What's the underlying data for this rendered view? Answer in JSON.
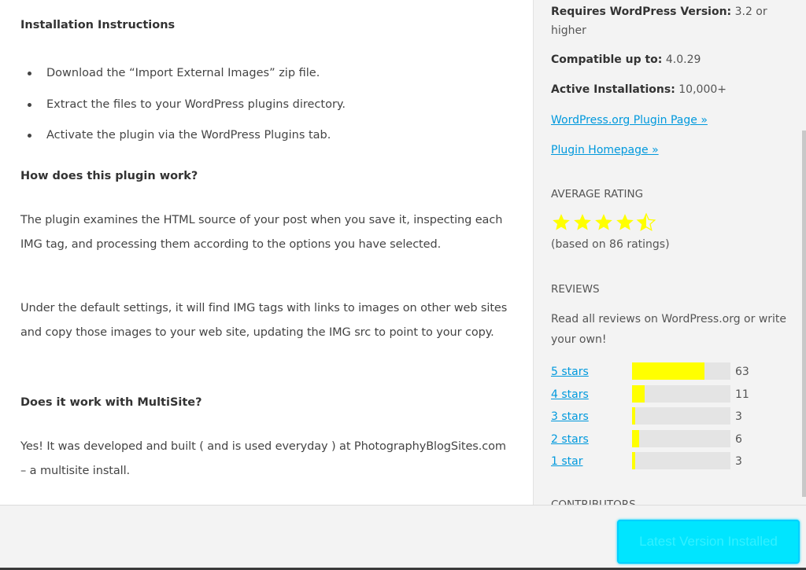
{
  "main": {
    "installation_title": "Installation Instructions",
    "installation_steps": [
      "Download the “Import External Images” zip file.",
      "Extract the files to your WordPress plugins directory.",
      "Activate the plugin via the WordPress Plugins tab."
    ],
    "faq": [
      {
        "question": "How does this plugin work?",
        "answers": [
          "The plugin examines the HTML source of your post when you save it, inspecting each IMG tag, and processing them according to the options you have selected.",
          "Under the default settings, it will find IMG tags with links to images on other web sites and copy those images to your web site, updating the IMG src to point to your copy."
        ]
      },
      {
        "question": "Does it work with MultiSite?",
        "answers": [
          "Yes! It was developed and built ( and is used everyday ) at PhotographyBlogSites.com – a multisite install."
        ]
      }
    ]
  },
  "sidebar": {
    "requires_label": "Requires WordPress Version:",
    "requires_value": " 3.2 or higher",
    "compatible_label": "Compatible up to:",
    "compatible_value": " 4.0.29",
    "active_label": "Active Installations:",
    "active_value": " 10,000+",
    "wp_plugin_page_link": "WordPress.org Plugin Page »",
    "plugin_homepage_link": "Plugin Homepage »",
    "average_rating_heading": "Average Rating",
    "average_rating_stars": 4.5,
    "based_on": "(based on 86 ratings)",
    "total_ratings": 86,
    "reviews_heading": "Reviews",
    "reviews_text": "Read all reviews on WordPress.org or write your own!",
    "rating_breakdown": [
      {
        "label": "5 stars",
        "count": 63
      },
      {
        "label": "4 stars",
        "count": 11
      },
      {
        "label": "3 stars",
        "count": 3
      },
      {
        "label": "2 stars",
        "count": 6
      },
      {
        "label": "1 star",
        "count": 3
      }
    ],
    "contributors_heading": "Contributors"
  },
  "footer": {
    "install_button_label": "Latest Version Installed"
  },
  "colors": {
    "star": "#ffff00",
    "bar_fill": "#ffff00",
    "link": "#0099dd",
    "button": "#00e5ff"
  }
}
